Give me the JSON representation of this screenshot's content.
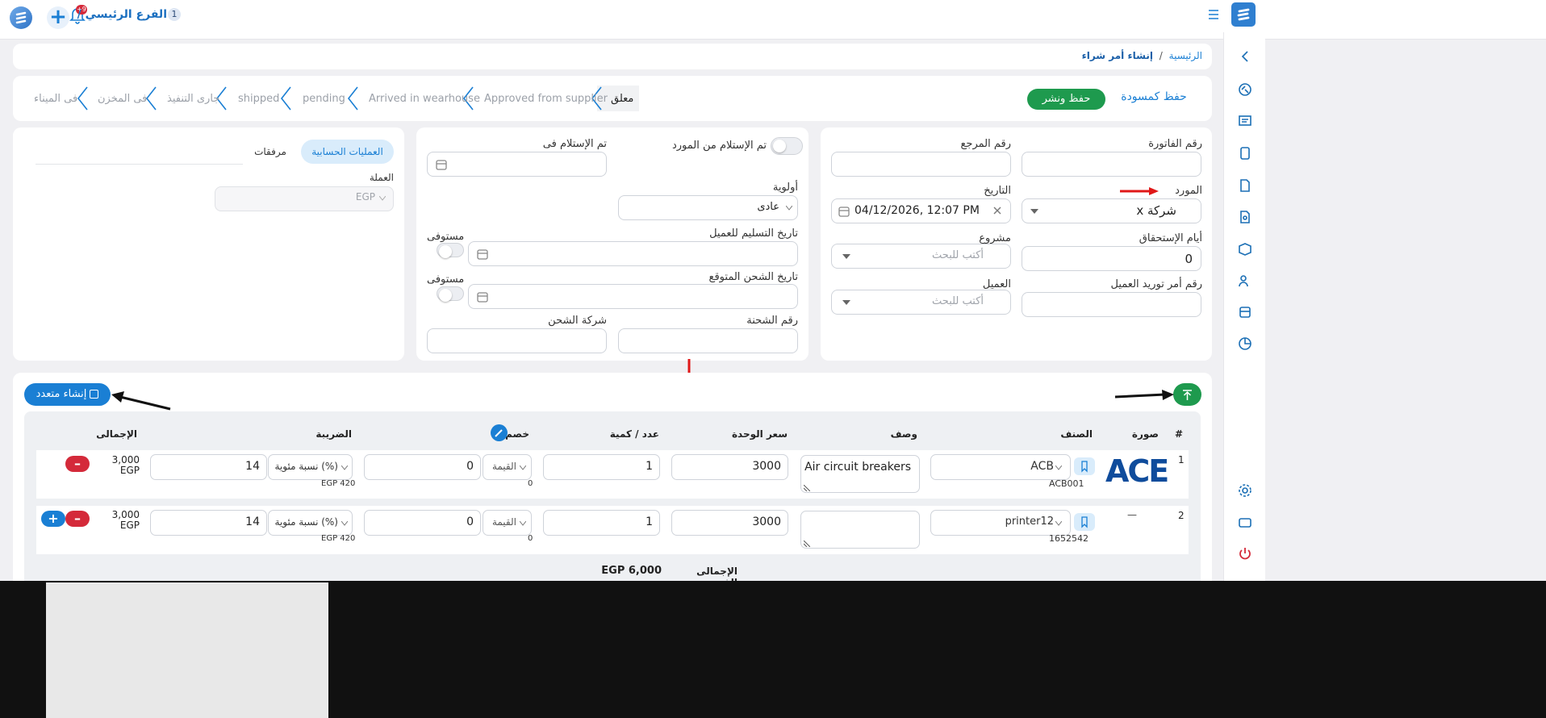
{
  "topbar": {
    "branch_badge": "1",
    "branch": "الفرع الرئيسي /",
    "notif_badge": "+9"
  },
  "breadcrumb": {
    "home": "الرئيسية",
    "sep": "/",
    "current": "إنشاء أمر شراء"
  },
  "actions": {
    "save_draft": "حفظ كمسودة",
    "save_publish": "حفظ ونشر"
  },
  "steps": [
    "معلق",
    "Approved from supplier",
    "Arrived in wearhouse",
    "pending",
    "shipped",
    "جارى التنفيذ",
    "فى المخزن",
    "فى الميناء"
  ],
  "form1": {
    "invoice_no": "رقم الفاتورة",
    "ref_no": "رقم المرجع",
    "supplier": "المورد",
    "supplier_value": "شركة x",
    "date": "التاريخ",
    "date_value": "04/12/2026, 12:07 PM",
    "due_days": "أيام الإستحقاق",
    "due_days_value": "0",
    "project": "مشروع",
    "project_ph": "أكتب للبحث",
    "client_po": "رقم أمر توريد العميل",
    "client": "العميل",
    "client_ph": "أكتب للبحث"
  },
  "form2": {
    "received_from_supplier": "تم الإستلام من المورد",
    "received_in": "تم الإستلام فى",
    "priority": "أولوية",
    "priority_value": "عادى",
    "delivery_date": "تاريخ التسليم للعميل",
    "fulfilled": "مستوفى",
    "expected_ship": "تاريخ الشحن المتوقع",
    "fulfilled2": "مستوفى",
    "shipment_no": "رقم الشحنة",
    "ship_company": "شركة الشحن"
  },
  "form3": {
    "tab_accounting": "العمليات الحسابية",
    "tab_attachments": "مرفقات",
    "currency_label": "العملة",
    "currency_value": "EGP"
  },
  "table": {
    "create_multi": "إنشاء متعدد",
    "headers": {
      "num": "#",
      "image": "صورة",
      "item": "الصنف",
      "desc": "وصف",
      "unit_price": "سعر الوحدة",
      "qty": "عدد / كمية",
      "discount": "خصم",
      "tax": "الضريبة",
      "total": "الإجمالى"
    },
    "rows": [
      {
        "num": "1",
        "item": "ACB",
        "code": "ACB001",
        "desc": "Air circuit breakers",
        "unit_price": "3000",
        "qty": "1",
        "disc_type": "القيمة",
        "disc_value": "0",
        "disc_sub": "0",
        "tax_type": "نسبة مئوية (%)",
        "tax_value": "14",
        "tax_sub": "EGP 420",
        "total1": "3,000",
        "total2": "EGP",
        "image_text": "ACE"
      },
      {
        "num": "2",
        "item": "printer12",
        "code": "1652542",
        "desc": "",
        "unit_price": "3000",
        "qty": "1",
        "disc_type": "القيمة",
        "disc_value": "0",
        "disc_sub": "0",
        "tax_type": "نسبة مئوية (%)",
        "tax_value": "14",
        "tax_sub": "EGP 420",
        "total1": "3,000",
        "total2": "EGP",
        "image_text": "—"
      }
    ],
    "subtotal_label": "الإجمالى الفرعى",
    "subtotal_value": "EGP 6,000"
  },
  "colors": {
    "primary": "#1a7fd4",
    "green": "#1e9a4e",
    "red": "#d42a3a",
    "arrow_red": "#e01818"
  }
}
